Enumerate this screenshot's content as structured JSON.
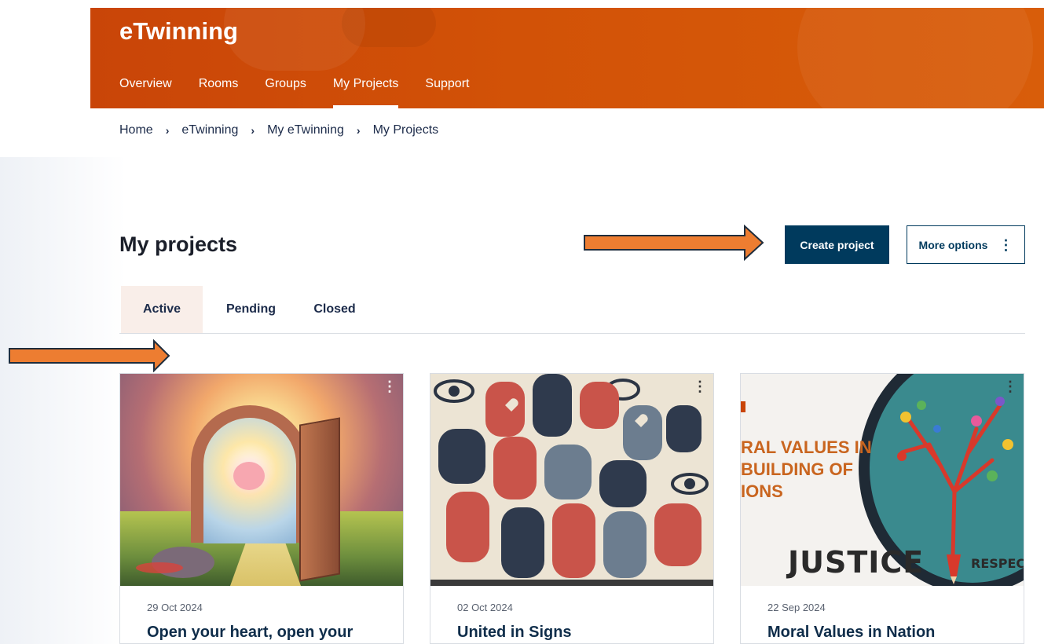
{
  "header": {
    "site_title": "eTwinning",
    "nav": [
      {
        "label": "Overview"
      },
      {
        "label": "Rooms"
      },
      {
        "label": "Groups"
      },
      {
        "label": "My Projects",
        "active": true
      },
      {
        "label": "Support"
      }
    ]
  },
  "breadcrumb": [
    "Home",
    "eTwinning",
    "My eTwinning",
    "My Projects"
  ],
  "page": {
    "title": "My projects",
    "create_button": "Create project",
    "more_options_button": "More options"
  },
  "tabs": [
    {
      "label": "Active",
      "selected": true
    },
    {
      "label": "Pending"
    },
    {
      "label": "Closed"
    }
  ],
  "cards": [
    {
      "date": "29 Oct 2024",
      "title": "Open your heart, open your",
      "image": "door-heart-image"
    },
    {
      "date": "02 Oct 2024",
      "title": "United in Signs",
      "image": "hands-signs-image"
    },
    {
      "date": "22 Sep 2024",
      "title": "Moral Values in Nation",
      "image": "moral-values-image",
      "image_text": {
        "line1": "RAL VALUES IN",
        "line2": "BUILDING OF",
        "line3": "IONS",
        "word1": "JUSTICE",
        "word2": "RESPECT"
      }
    }
  ],
  "colors": {
    "header": "#d25207",
    "primary": "#003a5d",
    "arrow": "#ed7d31",
    "arrow_border": "#1f2d3d",
    "active_tab_bg": "#f9eee9"
  }
}
